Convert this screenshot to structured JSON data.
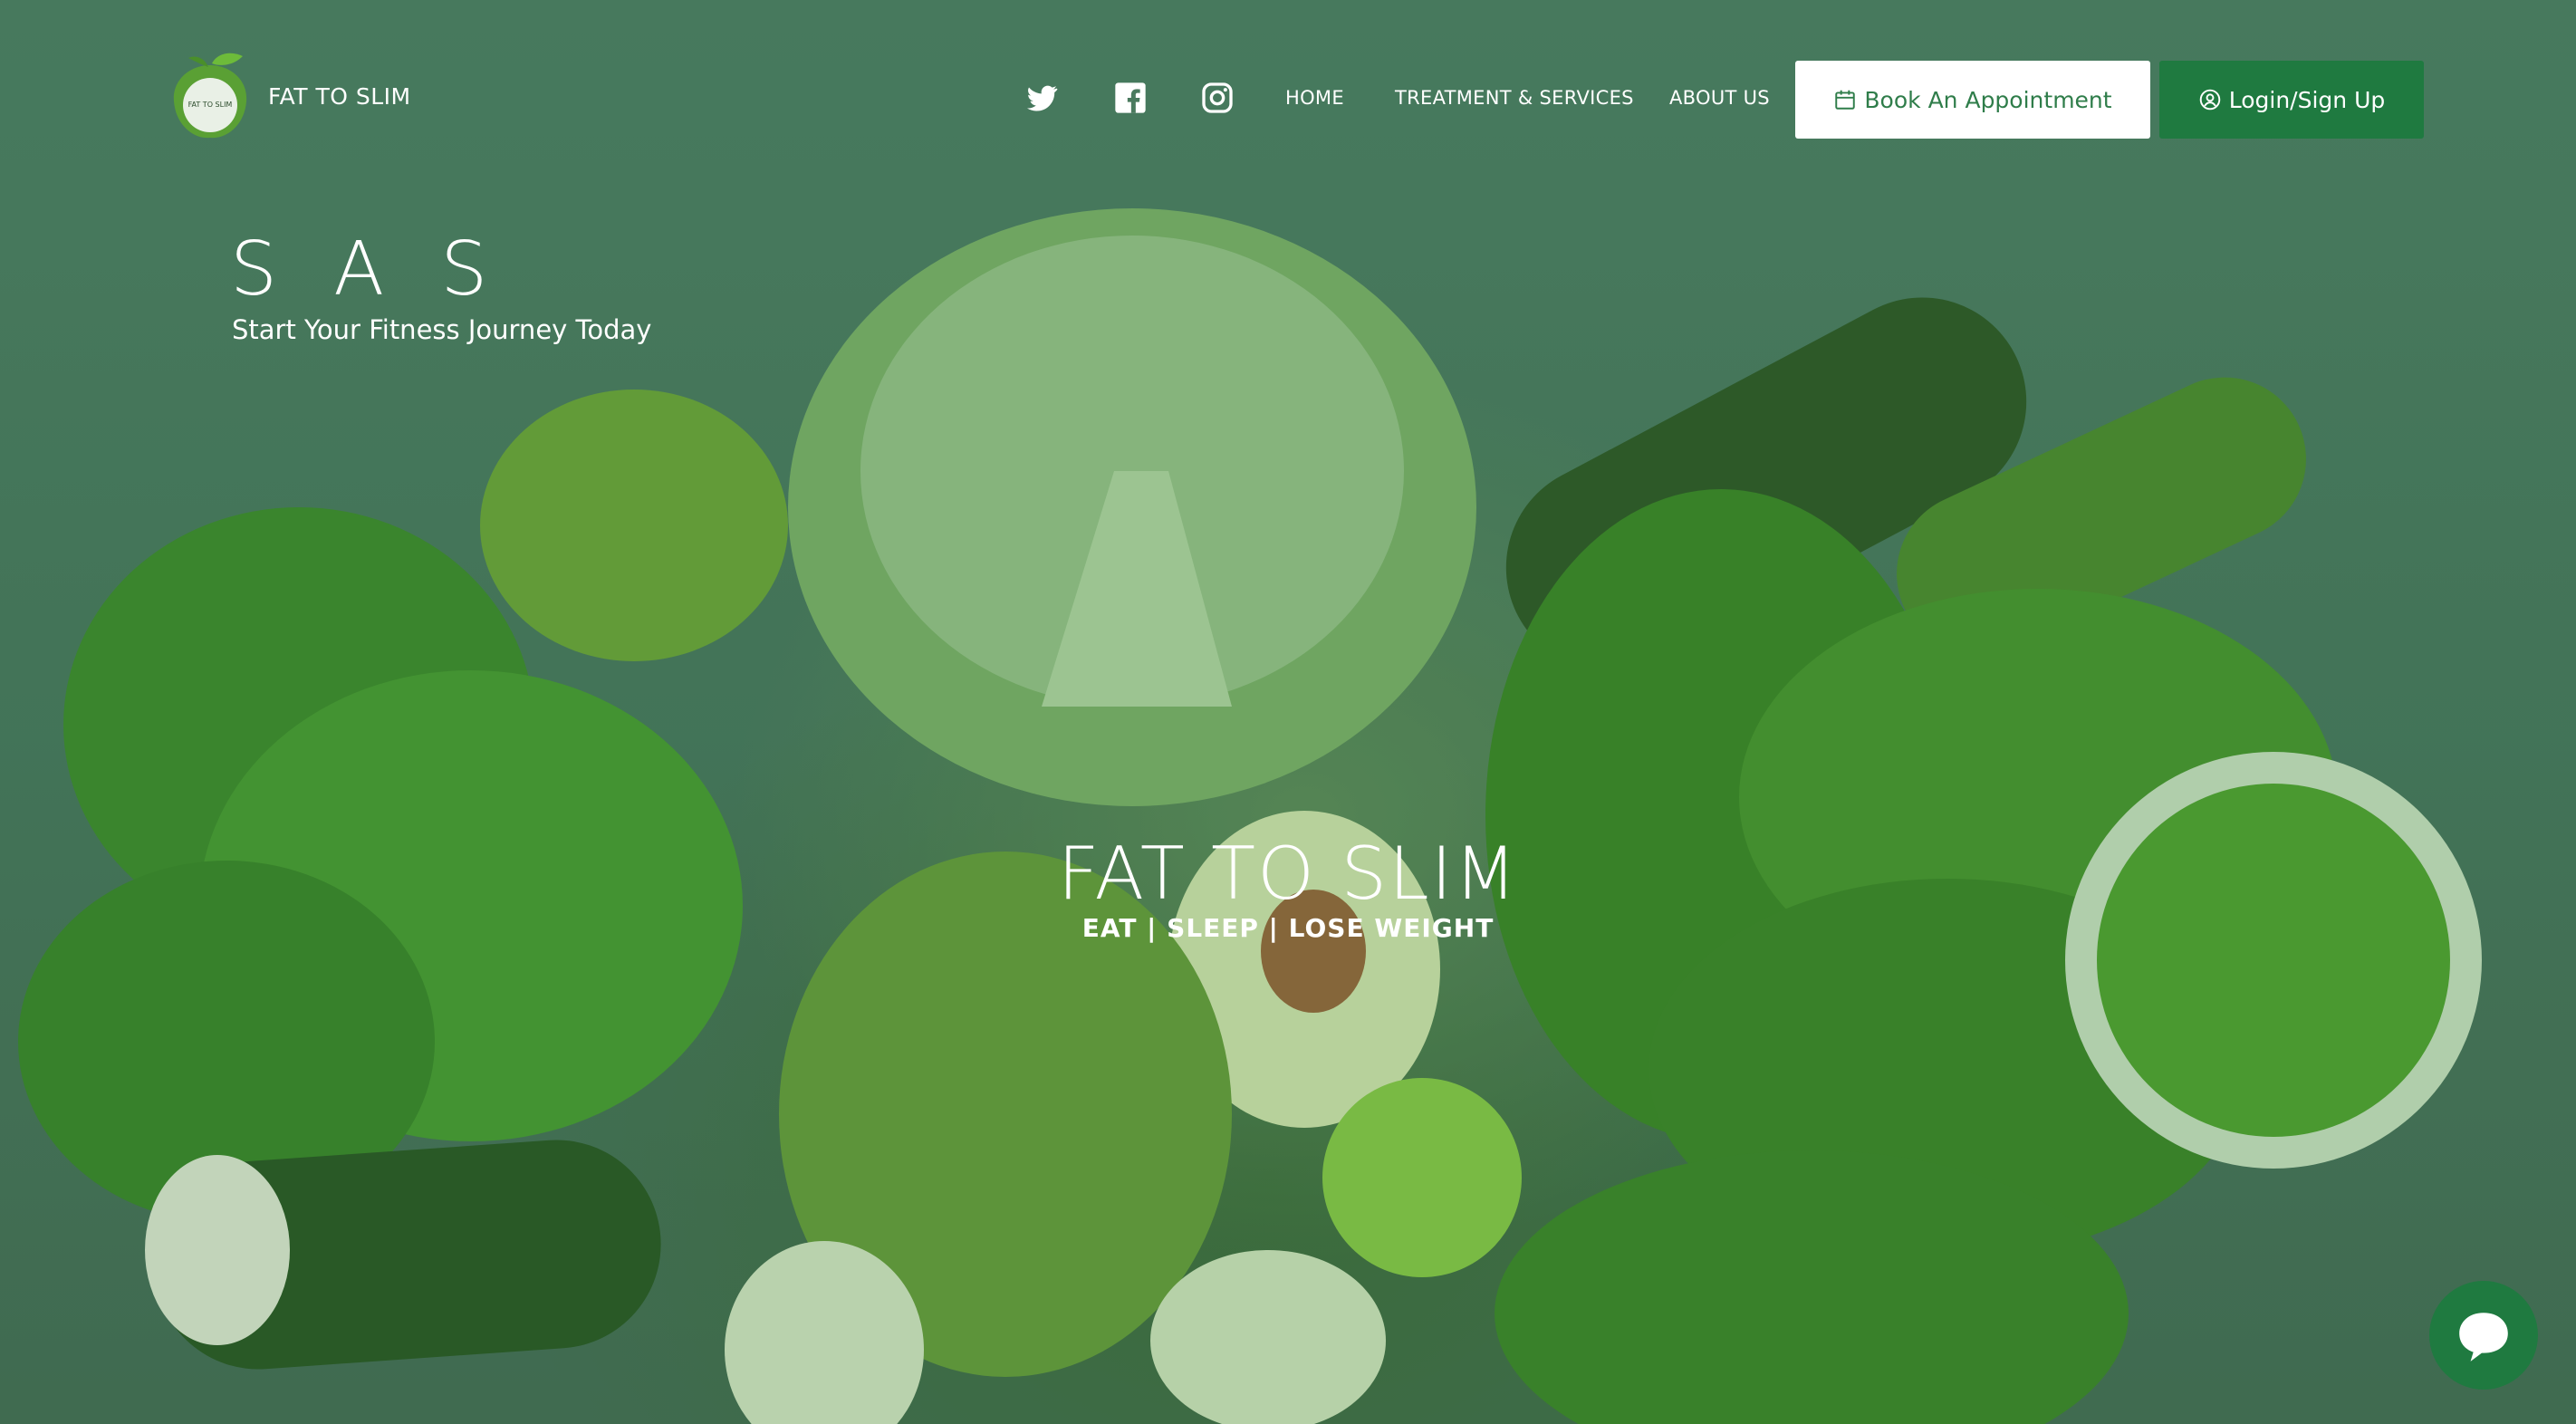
{
  "brand": {
    "name": "FAT TO SLIM",
    "logo_icon": "apple-leaf-logo-icon",
    "logo_badge_text": "FAT TO SLIM"
  },
  "social": [
    {
      "name": "twitter",
      "icon": "twitter-icon"
    },
    {
      "name": "facebook",
      "icon": "facebook-icon"
    },
    {
      "name": "instagram",
      "icon": "instagram-icon"
    }
  ],
  "nav": {
    "items": [
      {
        "label": "HOME"
      },
      {
        "label": "TREATMENT & SERVICES"
      },
      {
        "label": "ABOUT US"
      }
    ],
    "book_label": "Book An Appointment",
    "book_icon": "calendar-icon",
    "login_label": "Login/Sign Up",
    "login_icon": "user-circle-icon"
  },
  "hero": {
    "heading": "S A S",
    "tagline": "Start Your Fitness Journey Today",
    "center_title": "FAT TO SLIM",
    "center_subtitle": "EAT | SLEEP | LOSE WEIGHT"
  },
  "chat": {
    "icon": "chat-bubble-icon"
  },
  "colors": {
    "accent": "#1f7a40",
    "book_text": "#2f7d4a",
    "background": "#4a7a5e"
  }
}
